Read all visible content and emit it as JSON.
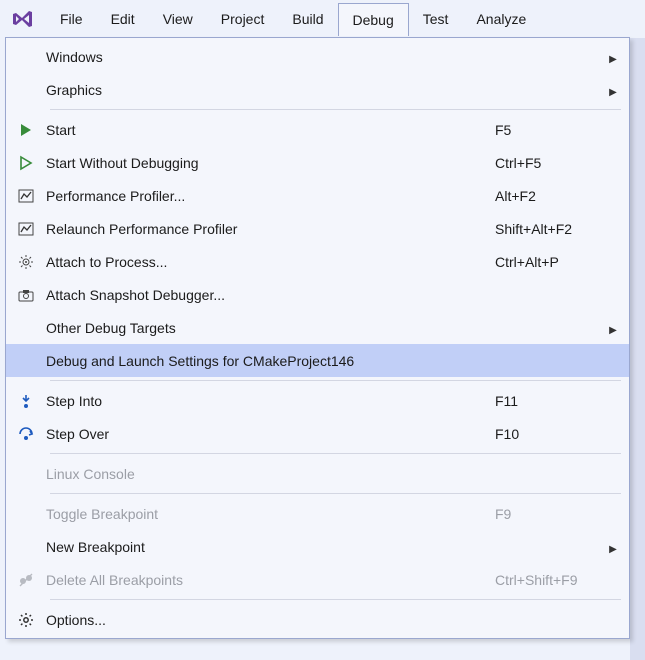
{
  "menubar": {
    "items": [
      {
        "label": "File"
      },
      {
        "label": "Edit"
      },
      {
        "label": "View"
      },
      {
        "label": "Project"
      },
      {
        "label": "Build"
      },
      {
        "label": "Debug",
        "open": true
      },
      {
        "label": "Test"
      },
      {
        "label": "Analyze"
      }
    ]
  },
  "dropdown": {
    "items": [
      {
        "label": "Windows",
        "submenu": true
      },
      {
        "label": "Graphics",
        "submenu": true
      },
      {
        "type": "sep"
      },
      {
        "label": "Start",
        "shortcut": "F5",
        "icon": "play-green"
      },
      {
        "label": "Start Without Debugging",
        "shortcut": "Ctrl+F5",
        "icon": "play-outline"
      },
      {
        "label": "Performance Profiler...",
        "shortcut": "Alt+F2",
        "icon": "profiler"
      },
      {
        "label": "Relaunch Performance Profiler",
        "shortcut": "Shift+Alt+F2",
        "icon": "profiler"
      },
      {
        "label": "Attach to Process...",
        "shortcut": "Ctrl+Alt+P",
        "icon": "attach-process"
      },
      {
        "label": "Attach Snapshot Debugger...",
        "icon": "snapshot"
      },
      {
        "label": "Other Debug Targets",
        "submenu": true
      },
      {
        "label": "Debug and Launch Settings for CMakeProject146",
        "highlight": true
      },
      {
        "type": "sep"
      },
      {
        "label": "Step Into",
        "shortcut": "F11",
        "icon": "step-into"
      },
      {
        "label": "Step Over",
        "shortcut": "F10",
        "icon": "step-over"
      },
      {
        "type": "sep"
      },
      {
        "label": "Linux Console",
        "disabled": true
      },
      {
        "type": "sep"
      },
      {
        "label": "Toggle Breakpoint",
        "shortcut": "F9",
        "disabled": true
      },
      {
        "label": "New Breakpoint",
        "submenu": true
      },
      {
        "label": "Delete All Breakpoints",
        "shortcut": "Ctrl+Shift+F9",
        "icon": "delete-breakpoints",
        "disabled": true
      },
      {
        "type": "sep"
      },
      {
        "label": "Options...",
        "icon": "gear"
      }
    ]
  }
}
